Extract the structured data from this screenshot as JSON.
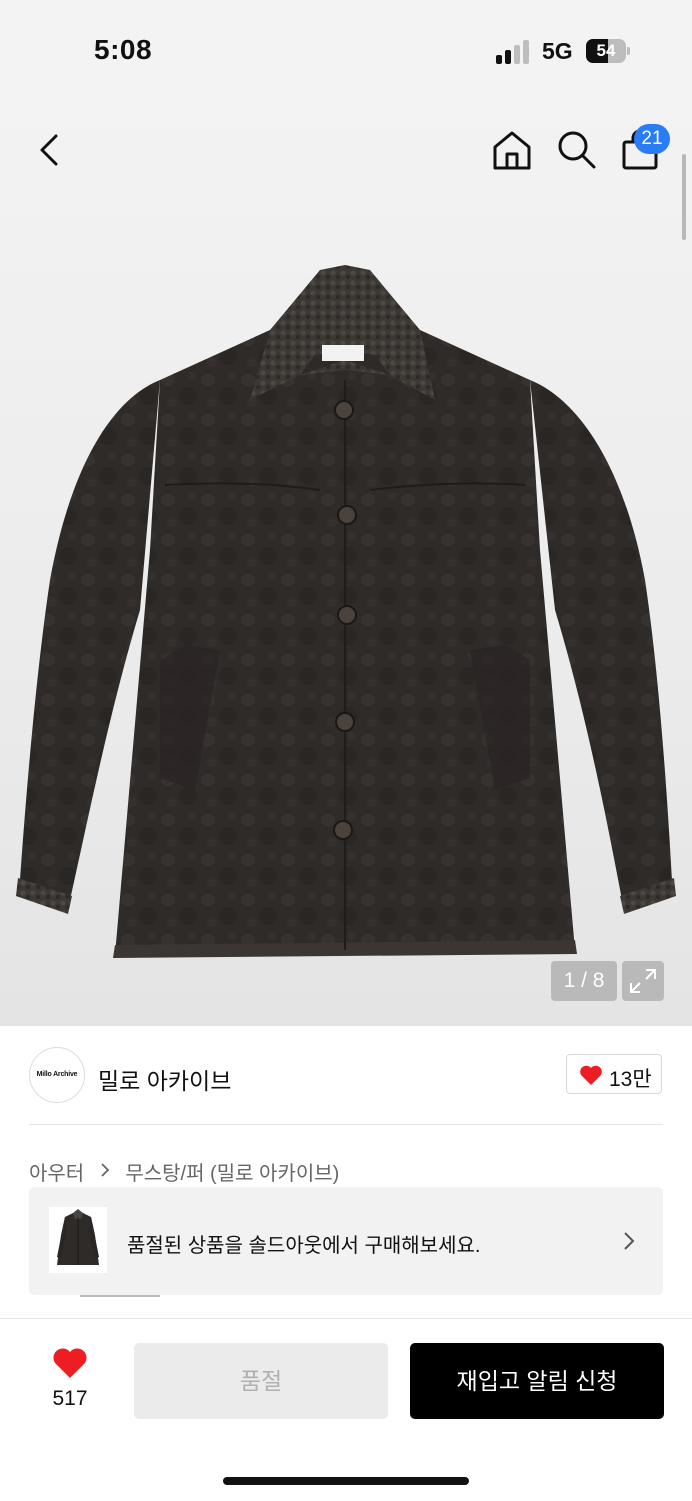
{
  "status_bar": {
    "time": "5:08",
    "network": "5G",
    "battery_level": "54",
    "battery_fraction": 0.54
  },
  "header": {
    "back_icon": "chevron-left-icon",
    "home_icon": "home-icon",
    "search_icon": "search-icon",
    "cart_icon": "shopping-bag-icon",
    "cart_badge": "21",
    "badge_color": "#2a7bf6"
  },
  "gallery": {
    "counter": "1 / 8",
    "expand_icon": "expand-icon"
  },
  "brand": {
    "logo_text": "Millo Archive",
    "name": "밀로 아카이브",
    "like_count": "13만",
    "heart_color": "#ee1d23"
  },
  "breadcrumb": {
    "items": [
      "아우터",
      "무스탕/퍼 (밀로 아카이브)"
    ]
  },
  "soldout_banner": {
    "text": "품절된 상품을 솔드아웃에서 구매해보세요."
  },
  "bottom_bar": {
    "wish_count": "517",
    "soldout_label": "품절",
    "restock_label": "재입고 알림 신청"
  }
}
